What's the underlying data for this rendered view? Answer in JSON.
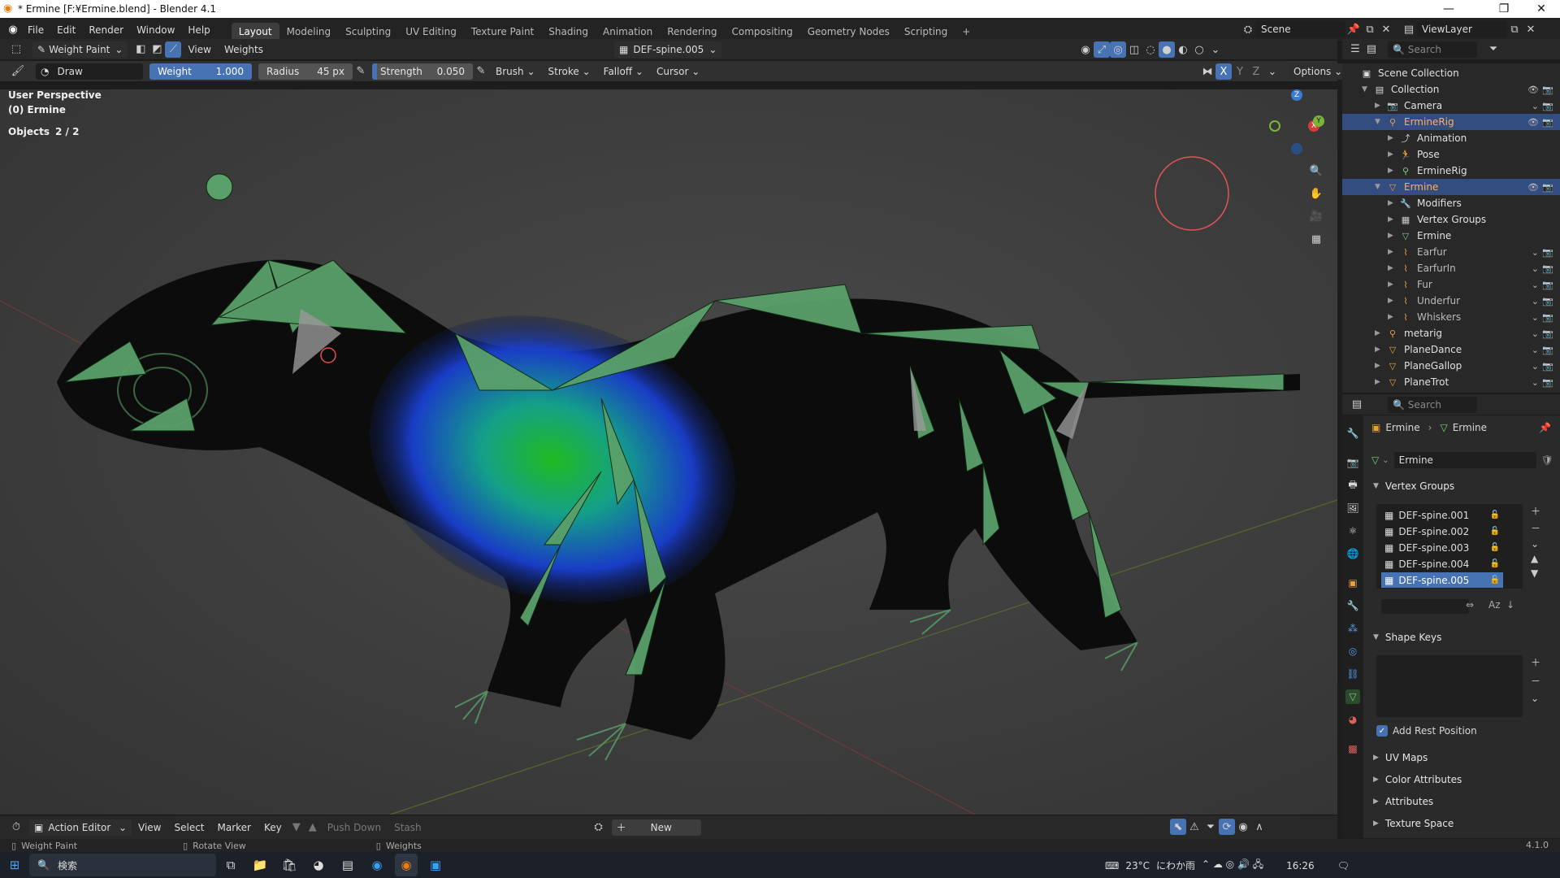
{
  "window": {
    "title": "* Ermine [F:¥Ermine.blend] - Blender 4.1"
  },
  "menu": [
    "File",
    "Edit",
    "Render",
    "Window",
    "Help"
  ],
  "workspaces": [
    "Layout",
    "Modeling",
    "Sculpting",
    "UV Editing",
    "Texture Paint",
    "Shading",
    "Animation",
    "Rendering",
    "Compositing",
    "Geometry Nodes",
    "Scripting",
    "+"
  ],
  "active_workspace": "Layout",
  "scene": {
    "label": "Scene",
    "viewlayer": "ViewLayer"
  },
  "header": {
    "mode": "Weight Paint",
    "view": "View",
    "weights": "Weights",
    "active_group": "DEF-spine.005",
    "options": "Options"
  },
  "tool": {
    "brush": "Draw",
    "weight_label": "Weight",
    "weight_value": "1.000",
    "radius_label": "Radius",
    "radius_value": "45 px",
    "strength_label": "Strength",
    "strength_value": "0.050",
    "brush_menu": "Brush",
    "stroke_menu": "Stroke",
    "falloff_menu": "Falloff",
    "cursor_menu": "Cursor",
    "axis_x": "X",
    "axis_y": "Y",
    "axis_z": "Z"
  },
  "viewport": {
    "perspective": "User Perspective",
    "object": "(0) Ermine",
    "objects_label": "Objects",
    "objects_count": "2 / 2"
  },
  "gizmo": {
    "z": "Z",
    "x": "X",
    "y": "Y"
  },
  "outliner": {
    "search_placeholder": "Search",
    "rows": [
      {
        "label": "Scene Collection",
        "icon": "scene-collection-icon"
      },
      {
        "label": "Collection",
        "icon": "collection-icon"
      },
      {
        "label": "Camera",
        "icon": "camera-icon"
      },
      {
        "label": "ErmineRig",
        "icon": "armature-icon"
      },
      {
        "label": "Animation",
        "icon": "action-icon"
      },
      {
        "label": "Pose",
        "icon": "pose-icon"
      },
      {
        "label": "ErmineRig",
        "icon": "armature-data-icon"
      },
      {
        "label": "Ermine",
        "icon": "mesh-object-icon"
      },
      {
        "label": "Modifiers",
        "icon": "wrench-icon"
      },
      {
        "label": "Vertex Groups",
        "icon": "vertex-groups-icon"
      },
      {
        "label": "Ermine",
        "icon": "mesh-data-icon"
      },
      {
        "label": "Earfur",
        "icon": "hair-icon"
      },
      {
        "label": "EarfurIn",
        "icon": "hair-icon"
      },
      {
        "label": "Fur",
        "icon": "hair-icon"
      },
      {
        "label": "Underfur",
        "icon": "hair-icon"
      },
      {
        "label": "Whiskers",
        "icon": "hair-icon"
      },
      {
        "label": "metarig",
        "icon": "armature-icon"
      },
      {
        "label": "PlaneDance",
        "icon": "mesh-object-icon"
      },
      {
        "label": "PlaneGallop",
        "icon": "mesh-object-icon"
      },
      {
        "label": "PlaneTrot",
        "icon": "mesh-object-icon"
      }
    ]
  },
  "properties": {
    "search_placeholder": "Search",
    "breadcrumb_object": "Ermine",
    "breadcrumb_data": "Ermine",
    "mesh_name": "Ermine",
    "vertex_groups_title": "Vertex Groups",
    "vertex_groups": [
      "DEF-spine.001",
      "DEF-spine.002",
      "DEF-spine.003",
      "DEF-spine.004",
      "DEF-spine.005"
    ],
    "shape_keys_title": "Shape Keys",
    "add_rest_position": "Add Rest Position",
    "uv_maps": "UV Maps",
    "color_attributes": "Color Attributes",
    "attributes": "Attributes",
    "texture_space": "Texture Space"
  },
  "timeline": {
    "editor": "Action Editor",
    "view": "View",
    "select": "Select",
    "marker": "Marker",
    "key": "Key",
    "push_down": "Push Down",
    "stash": "Stash",
    "new": "New"
  },
  "status": {
    "left": "Weight Paint",
    "mid": "Rotate View",
    "right": "Weights",
    "version": "4.1.0"
  },
  "taskbar": {
    "search": "検索",
    "temp": "23°C",
    "weather": "にわか雨",
    "time": "16:26"
  },
  "colors": {
    "accent": "#4772b3",
    "selected_row": "#334d80",
    "bone_green": "#5aa06a"
  }
}
